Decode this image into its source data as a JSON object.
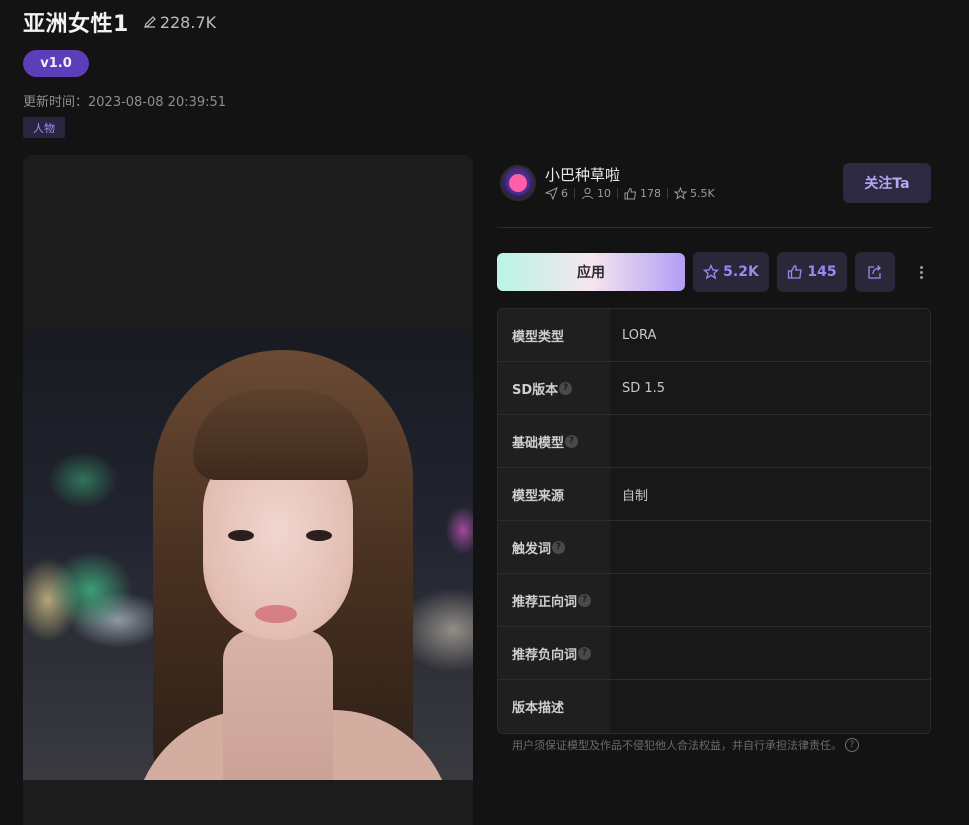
{
  "model": {
    "title": "亚洲女性1",
    "views": "228.7K",
    "version": "v1.0",
    "update_time": "更新时间：2023-08-08 20:39:51",
    "tag": "人物"
  },
  "author": {
    "name": "小巴种草啦",
    "stats": {
      "posts": "6",
      "followers": "10",
      "likes": "178",
      "favorites": "5.5K"
    },
    "follow_label": "关注Ta"
  },
  "actions": {
    "apply_label": "应用",
    "favorites": "5.2K",
    "likes": "145"
  },
  "info": [
    {
      "key": "模型类型",
      "help": false,
      "value": "LORA"
    },
    {
      "key": "SD版本",
      "help": true,
      "value": "SD 1.5"
    },
    {
      "key": "基础模型",
      "help": true,
      "value": ""
    },
    {
      "key": "模型来源",
      "help": false,
      "value": "自制"
    },
    {
      "key": "触发词",
      "help": true,
      "value": ""
    },
    {
      "key": "推荐正向词",
      "help": true,
      "value": ""
    },
    {
      "key": "推荐负向词",
      "help": true,
      "value": ""
    },
    {
      "key": "版本描述",
      "help": false,
      "value": ""
    }
  ],
  "disclaimer": "用户须保证模型及作品不侵犯他人合法权益，并自行承担法律责任。",
  "colors": {
    "accent": "#5b3fb8",
    "accent_text": "#9f86f2",
    "background": "#131313"
  }
}
